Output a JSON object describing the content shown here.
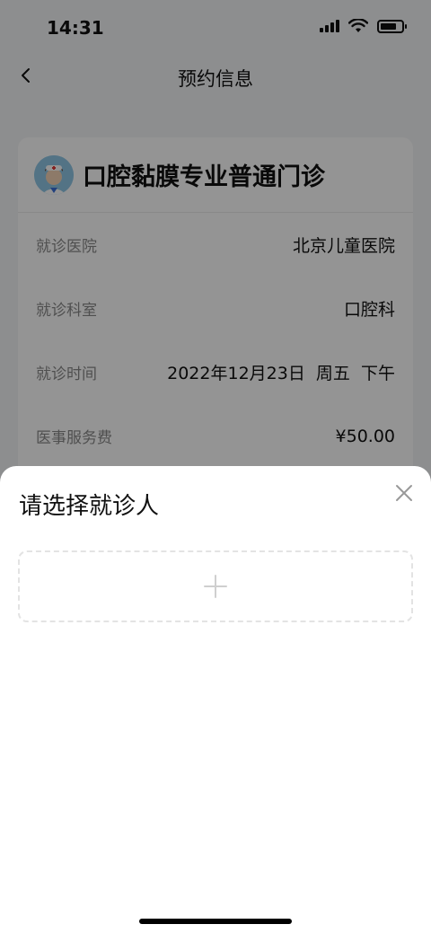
{
  "status_bar": {
    "time": "14:31",
    "icons": [
      "signal-icon",
      "wifi-icon",
      "battery-icon"
    ]
  },
  "nav": {
    "title": "预约信息",
    "back_icon": "chevron-left-icon"
  },
  "card": {
    "title": "口腔黏膜专业普通门诊",
    "avatar_icon": "doctor-avatar",
    "rows": [
      {
        "label": "就诊医院",
        "value": "北京儿童医院"
      },
      {
        "label": "就诊科室",
        "value": "口腔科"
      },
      {
        "label": "就诊时间",
        "value": "2022年12月23日  周五  下午"
      },
      {
        "label": "医事服务费",
        "value": "¥50.00"
      }
    ]
  },
  "sheet": {
    "title": "请选择就诊人",
    "close_icon": "close-icon",
    "add_icon": "plus-icon"
  },
  "colors": {
    "overlay": "#000000",
    "divider": "#ececec",
    "label": "#888888"
  }
}
